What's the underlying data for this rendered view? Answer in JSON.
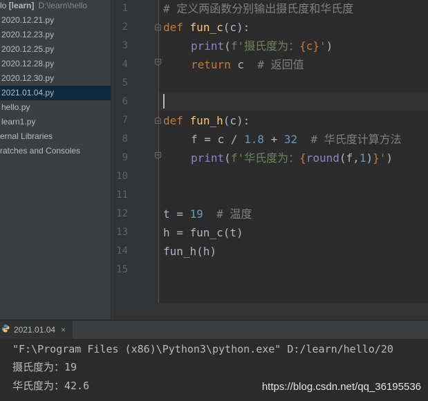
{
  "project": {
    "root_name": "lo",
    "root_bold": "[learn]",
    "root_path": "D:\\learn\\hello",
    "files": [
      {
        "name": "2020.12.21.py"
      },
      {
        "name": "2020.12.23.py"
      },
      {
        "name": "2020.12.25.py"
      },
      {
        "name": "2020.12.28.py"
      },
      {
        "name": "2020.12.30.py"
      },
      {
        "name": "2021.01.04.py",
        "selected": true
      },
      {
        "name": "hello.py"
      },
      {
        "name": "learn1.py"
      }
    ],
    "external_libraries": "ernal Libraries",
    "scratches": "ratches and Consoles"
  },
  "editor": {
    "line_numbers": [
      "1",
      "2",
      "3",
      "4",
      "5",
      "6",
      "7",
      "8",
      "9",
      "10",
      "11",
      "12",
      "13",
      "14",
      "15"
    ],
    "code": {
      "l1_comment": "# 定义两函数分别输出摄氏度和华氏度",
      "l2_def": "def",
      "l2_name": "fun_c",
      "l2_rest": "(c):",
      "l3_print": "print",
      "l3_open": "(",
      "l3_str1": "f'摄氏度为：",
      "l3_expr": "{c}",
      "l3_str2": "'",
      "l3_close": ")",
      "l4_return": "return",
      "l4_rest": " c  ",
      "l4_comment": "# 返回值",
      "l7_def": "def",
      "l7_name": "fun_h",
      "l7_rest": "(c):",
      "l8_a": "f = c / ",
      "l8_n1": "1.8",
      "l8_b": " + ",
      "l8_n2": "32",
      "l8_sp": "  ",
      "l8_comment": "# 华氏度计算方法",
      "l9_print": "print",
      "l9_open": "(",
      "l9_str1": "f'华氏度为：",
      "l9_brace": "{",
      "l9_round": "round",
      "l9_args_a": "(f,",
      "l9_n": "1",
      "l9_args_b": ")",
      "l9_brace2": "}",
      "l9_str2": "'",
      "l9_close": ")",
      "l12_a": "t = ",
      "l12_n": "19",
      "l12_sp": "  ",
      "l12_comment": "# 温度",
      "l13": "h = fun_c(t)",
      "l14": "fun_h(h)"
    }
  },
  "run": {
    "tab_label": "2021.01.04",
    "close_symbol": "×",
    "output": [
      "\"F:\\Program Files (x86)\\Python3\\python.exe\" D:/learn/hello/20",
      "摄氏度为：19",
      "华氏度为：42.6"
    ],
    "watermark": "https://blog.csdn.net/qq_36195536"
  },
  "colors": {
    "keyword": "#cc7832",
    "function": "#ffc66d",
    "builtin": "#8888c6",
    "string": "#6a8759",
    "number": "#6897bb",
    "comment": "#808080",
    "selection": "#0d293e"
  }
}
